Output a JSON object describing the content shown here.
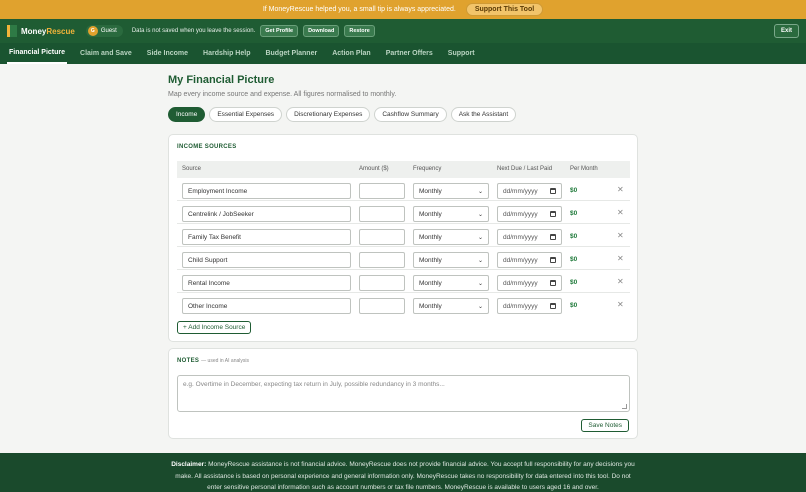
{
  "tipbar": {
    "message": "If MoneyRescue helped you, a small tip is always appreciated.",
    "button": "Support This Tool"
  },
  "topbar": {
    "logo_part1": "Money",
    "logo_part2": "Rescue",
    "guest_initial": "G",
    "guest_label": "Guest",
    "notice": "Data is not saved when you leave the session.",
    "buttons": [
      "Get Profile",
      "Download",
      "Restore"
    ],
    "exit": "Exit"
  },
  "nav": [
    "Financial Picture",
    "Claim and Save",
    "Side Income",
    "Hardship Help",
    "Budget Planner",
    "Action Plan",
    "Partner Offers",
    "Support"
  ],
  "page": {
    "title": "My Financial Picture",
    "subtitle": "Map every income source and expense. All figures normalised to monthly.",
    "tabs": [
      "Income",
      "Essential Expenses",
      "Discretionary Expenses",
      "Cashflow Summary",
      "Ask the Assistant"
    ]
  },
  "income": {
    "title": "INCOME SOURCES",
    "columns": [
      "Source",
      "Amount ($)",
      "Frequency",
      "Next Due / Last Paid",
      "Per Month"
    ],
    "rows": [
      {
        "source": "Employment Income",
        "amount": "",
        "frequency": "Monthly",
        "date": "dd/mm/yyyy",
        "per_month": "$0"
      },
      {
        "source": "Centrelink / JobSeeker",
        "amount": "",
        "frequency": "Monthly",
        "date": "dd/mm/yyyy",
        "per_month": "$0"
      },
      {
        "source": "Family Tax Benefit",
        "amount": "",
        "frequency": "Monthly",
        "date": "dd/mm/yyyy",
        "per_month": "$0"
      },
      {
        "source": "Child Support",
        "amount": "",
        "frequency": "Monthly",
        "date": "dd/mm/yyyy",
        "per_month": "$0"
      },
      {
        "source": "Rental Income",
        "amount": "",
        "frequency": "Monthly",
        "date": "dd/mm/yyyy",
        "per_month": "$0"
      },
      {
        "source": "Other Income",
        "amount": "",
        "frequency": "Monthly",
        "date": "dd/mm/yyyy",
        "per_month": "$0"
      }
    ],
    "add_button": "+ Add Income Source"
  },
  "notes": {
    "title": "NOTES",
    "hint": "— used in AI analysis",
    "placeholder": "e.g. Overtime in December, expecting tax return in July, possible redundancy in 3 months...",
    "save_button": "Save Notes"
  },
  "footer": {
    "label": "Disclaimer:",
    "text": "MoneyRescue assistance is not financial advice. MoneyRescue does not provide financial advice. You accept full responsibility for any decisions you make. All assistance is based on personal experience and general information only. MoneyRescue takes no responsibility for data entered into this tool. Do not enter sensitive personal information such as account numbers or tax file numbers. MoneyRescue is available to users aged 16 and over."
  }
}
